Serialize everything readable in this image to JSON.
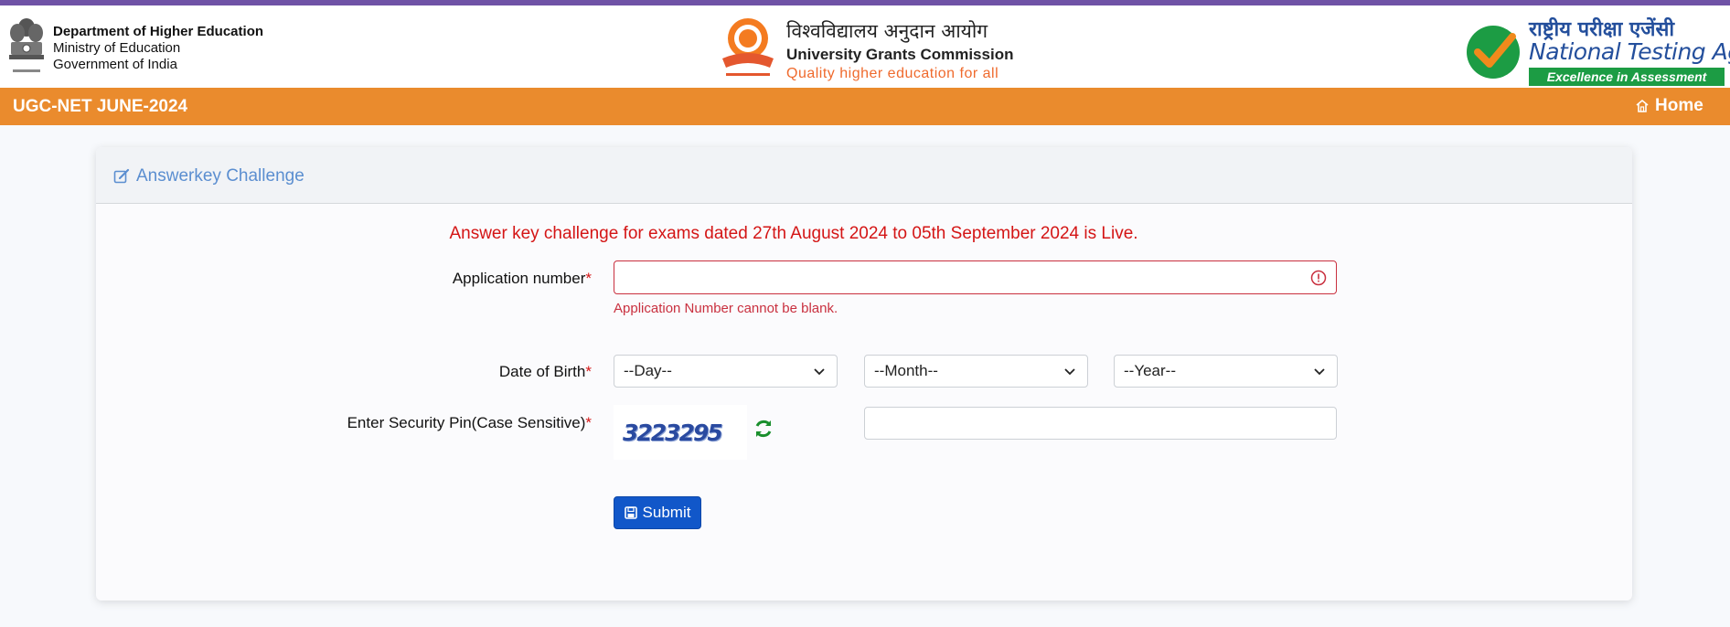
{
  "header": {
    "left": {
      "line1": "Department of Higher Education",
      "line2": "Ministry of Education",
      "line3": "Government of India"
    },
    "center": {
      "hindi": "विश्वविद्यालय अनुदान आयोग",
      "english": "University Grants Commission",
      "tagline": "Quality higher education for all"
    },
    "right": {
      "hindi": "राष्ट्रीय परीक्षा एजेंसी",
      "english": "National Testing Agency",
      "tagline": "Excellence in Assessment"
    }
  },
  "nav": {
    "title": "UGC-NET JUNE-2024",
    "home_label": "Home"
  },
  "card": {
    "title": "Answerkey Challenge",
    "notice": "Answer key challenge for exams dated 27th August 2024 to 05th September 2024 is Live."
  },
  "form": {
    "application_label": "Application number",
    "application_value": "",
    "application_error": "Application Number cannot be blank.",
    "dob_label": "Date of Birth",
    "day_selected": "--Day--",
    "month_selected": "--Month--",
    "year_selected": "--Year--",
    "pin_label": "Enter Security Pin(Case Sensitive)",
    "captcha_text": "3223295",
    "pin_value": "",
    "required_mark": "*",
    "submit_label": "Submit"
  },
  "colors": {
    "nav_orange": "#ea8b2d",
    "top_purple": "#6f52a6",
    "error_red": "#d41515",
    "title_blue": "#5b8ed0",
    "submit_blue": "#1157c9"
  }
}
